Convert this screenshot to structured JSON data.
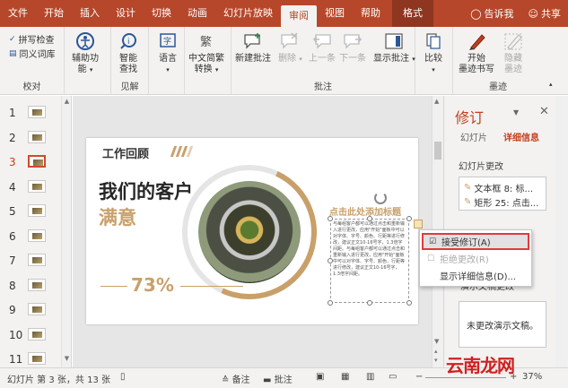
{
  "tabs": [
    "文件",
    "开始",
    "插入",
    "设计",
    "切换",
    "动画",
    "幻灯片放映",
    "审阅",
    "视图",
    "帮助",
    "格式"
  ],
  "active_tab": "审阅",
  "tell_me": "告诉我",
  "share": "共享",
  "ribbon": {
    "proofing": {
      "spell_check": "拼写检查",
      "thesaurus": "同义词库",
      "label": "校对"
    },
    "accessibility": {
      "line1": "辅助功",
      "line2": "能",
      "label": ""
    },
    "insights": {
      "line1": "智能",
      "line2": "查找",
      "label": "见解"
    },
    "language": {
      "line1": "语言",
      "label": ""
    },
    "chinese_conv": {
      "line1": "中文简繁",
      "line2": "转换",
      "label": ""
    },
    "comments": {
      "new": "新建批注",
      "delete": "删除",
      "prev": "上一条",
      "next": "下一条",
      "show": "显示批注",
      "label": "批注"
    },
    "compare": {
      "line1": "比较"
    },
    "ink": {
      "start_line1": "开始",
      "start_line2": "墨迹书写",
      "hide_line1": "隐藏",
      "hide_line2": "墨迹",
      "label": "墨迹"
    }
  },
  "thumbnails": [
    "1",
    "2",
    "3",
    "4",
    "5",
    "6",
    "7",
    "8",
    "9",
    "10",
    "11"
  ],
  "selected_slide": "3",
  "slide": {
    "section_title": "工作回顾",
    "headline1": "我们的客户",
    "headline2": "满意",
    "percent": "73%",
    "title_placeholder": "点击此处添加标题",
    "body_text": "与每组客户都可以通过点击和重新输入进行更改，应用\"开始\"面板中可以对字体、字号、颜色、行距等进行修改，建议正文10-16号字，1.3倍字间距。与每组客户都可以通过点击和重新输入进行更改，应用\"开始\"面板中可以对字体、字号、颜色、行距等进行修改，建议正文10-16号字，1.3倍字间距。"
  },
  "context_menu": {
    "accept": "接受修订(A)",
    "reject": "拒绝更改(R)",
    "details": "显示详细信息(D)..."
  },
  "revisions": {
    "title": "修订",
    "tab_slides": "幻灯片",
    "tab_details": "详细信息",
    "slide_changes": "幻灯片更改",
    "items": [
      "文本框 8: 标...",
      "矩形 25: 点击..."
    ],
    "presentation_changes": "演示文稿更改",
    "no_changes": "未更改演示文稿。"
  },
  "status": {
    "slide_info": "幻灯片 第 3 张，共 13 张",
    "notes": "备注",
    "comments": "批注",
    "zoom": "37%"
  },
  "watermark": "云南龙网"
}
